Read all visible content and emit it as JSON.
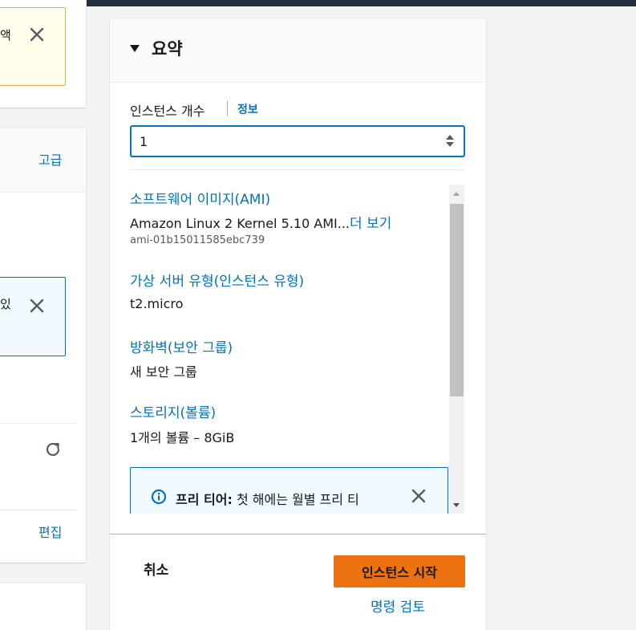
{
  "left": {
    "warning_snippet": "액",
    "info_snippet": "있",
    "advanced_link": "고급",
    "edit_link": "편집"
  },
  "summary": {
    "title": "요약",
    "instance_count": {
      "label": "인스턴스 개수",
      "info_link": "정보",
      "value": "1"
    },
    "software_image": {
      "title": "소프트웨어 이미지(AMI)",
      "value": "Amazon Linux 2 Kernel 5.10 AMI...",
      "more_link": "더 보기",
      "ami_id": "ami-01b15011585ebc739"
    },
    "server_type": {
      "title": "가상 서버 유형(인스턴스 유형)",
      "value": "t2.micro"
    },
    "firewall": {
      "title": "방화벽(보안 그룹)",
      "value": "새 보안 그룹"
    },
    "storage": {
      "title": "스토리지(볼륨)",
      "value": "1개의 볼륨 – 8GiB"
    },
    "free_tier": {
      "label": "프리 티어:",
      "text": "첫 해에는 월별 프리 티"
    }
  },
  "actions": {
    "cancel": "취소",
    "launch": "인스턴스 시작",
    "review": "명령 검토"
  },
  "colors": {
    "link": "#0073bb",
    "primary_button": "#ec7211",
    "warning_bg": "#fffce9",
    "info_bg": "#f1faff"
  },
  "icons": {
    "close": "close-icon",
    "refresh": "refresh-icon",
    "info": "info-circle-icon",
    "caret": "caret-down-icon"
  }
}
